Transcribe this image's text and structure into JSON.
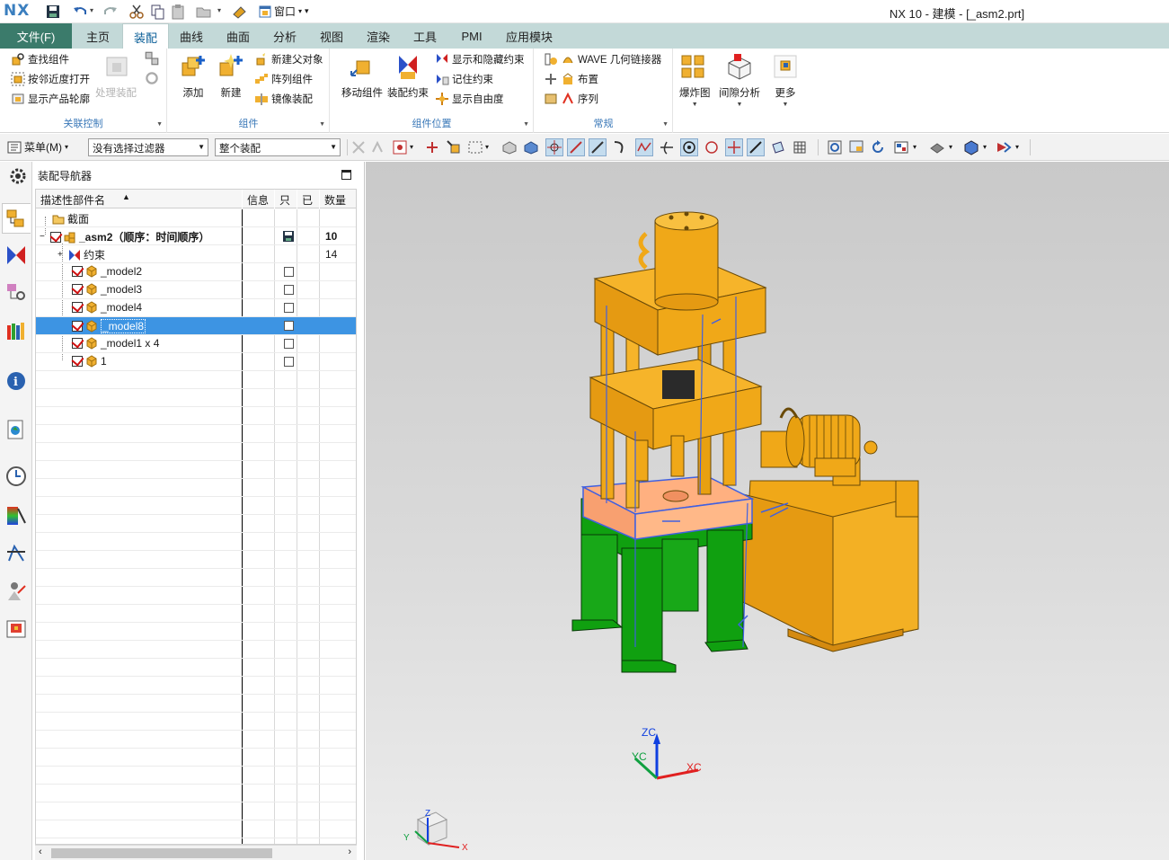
{
  "app": {
    "logo": "NX",
    "window_title": "NX 10 - 建模 - [_asm2.prt]",
    "window_menu": "窗口"
  },
  "tabs": {
    "file": "文件(F)",
    "items": [
      "主页",
      "装配",
      "曲线",
      "曲面",
      "分析",
      "视图",
      "渲染",
      "工具",
      "PMI",
      "应用模块"
    ],
    "active": "装配"
  },
  "ribbon": {
    "group1": {
      "label": "关联控制",
      "items": [
        "查找组件",
        "按邻近度打开",
        "显示产品轮廓"
      ],
      "large": "处理装配"
    },
    "group2": {
      "label": "组件",
      "large": [
        "添加",
        "新建"
      ],
      "items": [
        "新建父对象",
        "阵列组件",
        "镜像装配"
      ]
    },
    "group3": {
      "label": "组件位置",
      "large": [
        "移动组件",
        "装配约束"
      ],
      "items": [
        "显示和隐藏约束",
        "记住约束",
        "显示自由度"
      ]
    },
    "group4": {
      "label": "常规",
      "items": [
        "WAVE 几何链接器",
        "布置",
        "序列"
      ]
    },
    "group5": {
      "large": [
        "爆炸图",
        "间隙分析",
        "更多"
      ]
    }
  },
  "selbar": {
    "menu": "菜单(M)",
    "filter": "没有选择过滤器",
    "scope": "整个装配"
  },
  "navigator": {
    "title": "装配导航器",
    "columns": [
      "描述性部件名",
      "信息",
      "只",
      "已",
      "数量"
    ],
    "rows": [
      {
        "name": "截面",
        "qty": ""
      },
      {
        "name": "_asm2（顺序：时间顺序）",
        "qty": "10"
      },
      {
        "name": "约束",
        "qty": "14"
      },
      {
        "name": "_model2",
        "qty": ""
      },
      {
        "name": "_model3",
        "qty": ""
      },
      {
        "name": "_model4",
        "qty": ""
      },
      {
        "name": "_model8",
        "qty": ""
      },
      {
        "name": "_model1 x 4",
        "qty": ""
      },
      {
        "name": "1",
        "qty": ""
      }
    ],
    "selected_row": "_model8"
  },
  "viewport": {
    "triad": {
      "z": "ZC",
      "y": "YC",
      "x": "XC"
    },
    "mini_triad": {
      "z": "Z",
      "y": "Y",
      "x": "X"
    },
    "colors": {
      "press_body": "#f0a818",
      "base": "#10a010",
      "constraint": "#4060e0",
      "selection": "#ffb080"
    }
  }
}
